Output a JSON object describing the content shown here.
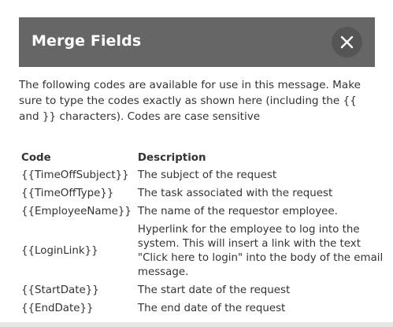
{
  "dialog": {
    "title": "Merge Fields",
    "close_icon": "close-icon",
    "intro": "The following codes are available for use in this message. Make sure to type the codes exactly as shown here (including the {{ and }} characters). Codes are case sensitive"
  },
  "table": {
    "headers": {
      "code": "Code",
      "description": "Description"
    },
    "rows": [
      {
        "code": "{{TimeOffSubject}}",
        "description": "The subject of the request"
      },
      {
        "code": "{{TimeOffType}}",
        "description": "The task associated with the request"
      },
      {
        "code": "{{EmployeeName}}",
        "description": "The name of the requestor employee."
      },
      {
        "code": "{{LoginLink}}",
        "description": "Hyperlink for the employee to log into the system. This will insert a link with the text \"Click here to login\" into the body of the email message."
      },
      {
        "code": "{{StartDate}}",
        "description": "The start date of the request"
      },
      {
        "code": "{{EndDate}}",
        "description": "The end date of the request"
      }
    ]
  },
  "colors": {
    "header_bg": "#666666",
    "close_bg": "#555555",
    "text": "#333333"
  }
}
